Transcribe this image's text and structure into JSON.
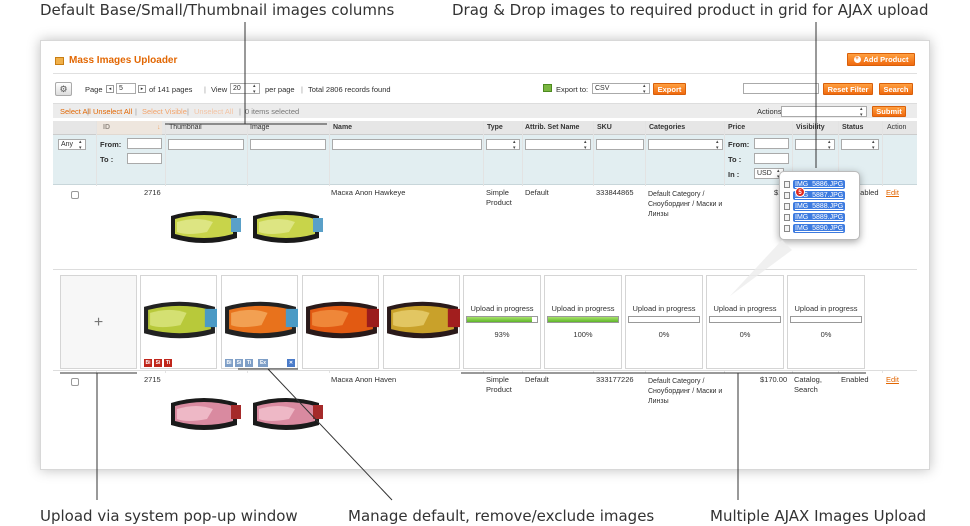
{
  "callouts": {
    "top_left": "Default Base/Small/Thumbnail images columns",
    "top_right": "Drag & Drop images to required product in grid for AJAX upload",
    "bottom_left": "Upload via system pop-up window",
    "bottom_center": "Manage default, remove/exclude images",
    "bottom_right": "Multiple AJAX Images Upload"
  },
  "header": {
    "title": "Mass Images Uploader",
    "add_product": "Add Product"
  },
  "pager": {
    "page_label": "Page",
    "page_value": "5",
    "of_pages": "of 141 pages",
    "view_label": "View",
    "view_value": "20",
    "per_page": "per page",
    "total": "Total 2806 records found",
    "export_label": "Export to:",
    "export_value": "CSV",
    "export_btn": "Export",
    "reset_filter": "Reset Filter",
    "search": "Search"
  },
  "massaction": {
    "select_all": "Select All",
    "unselect_all": "Unselect All",
    "select_visible": "Select Visible",
    "unselect_visible": "Unselect All",
    "items_selected": "0 items selected",
    "actions_label": "Actions",
    "submit": "Submit"
  },
  "columns": {
    "id": "ID",
    "thumbnail": "Thumbnail",
    "image": "Image",
    "name": "Name",
    "type": "Type",
    "attr_set": "Attrib. Set Name",
    "sku": "SKU",
    "categories": "Categories",
    "price": "Price",
    "visibility": "Visibility",
    "status": "Status",
    "action": "Action"
  },
  "filters": {
    "any": "Any",
    "from": "From:",
    "to": "To :",
    "in": "In :",
    "currency": "USD"
  },
  "rows": [
    {
      "id": "2716",
      "name": "Маска Anon Hawkeye",
      "type": "Simple Product",
      "attr_set": "Default",
      "sku": "333844865",
      "categories": "Default Category / Сноубординг / Маски и Линзы",
      "price": "$185",
      "visibility": "",
      "status": "nabled",
      "action": "Edit"
    },
    {
      "id": "2715",
      "name": "Маска Anon Haven",
      "type": "Simple Product",
      "attr_set": "Default",
      "sku": "333177226",
      "categories": "Default Category / Сноубординг / Маски и Линзы",
      "price": "$170.00",
      "visibility": "Catalog, Search",
      "status": "Enabled",
      "action": "Edit"
    }
  ],
  "uploader": {
    "add": "+",
    "image_badges_1": [
      "Bi",
      "Si",
      "Ti"
    ],
    "image_badges_2": [
      "Bi",
      "Si",
      "Ti",
      "Ex"
    ],
    "remove": "✕",
    "uploads": [
      {
        "label": "Upload in progress",
        "percent": 93,
        "text": "93%"
      },
      {
        "label": "Upload in progress",
        "percent": 100,
        "text": "100%"
      },
      {
        "label": "Upload in progress",
        "percent": 0,
        "text": "0%"
      },
      {
        "label": "Upload in progress",
        "percent": 0,
        "text": "0%"
      },
      {
        "label": "Upload in progress",
        "percent": 0,
        "text": "0%"
      }
    ]
  },
  "drag_popup": {
    "count": "5",
    "files": [
      "IMG_5886.JPG",
      "IMG_5887.JPG",
      "IMG_5888.JPG",
      "IMG_5889.JPG",
      "IMG_5890.JPG"
    ]
  },
  "colors": {
    "accent": "#f06a0f",
    "title": "#e26703",
    "progress": "#5fb52a",
    "file_highlight": "#3d7be0"
  }
}
